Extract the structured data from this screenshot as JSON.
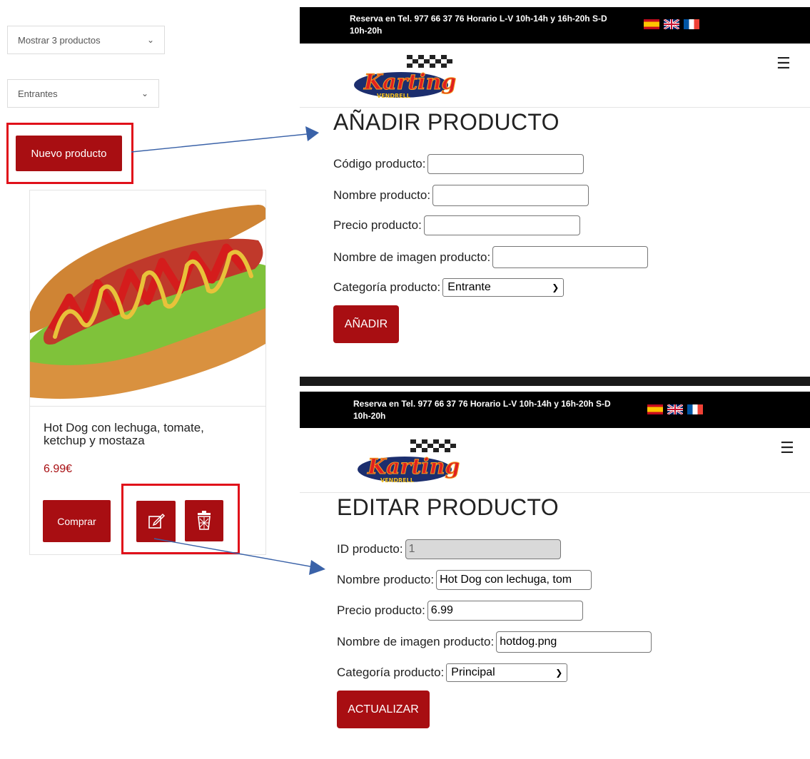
{
  "left": {
    "show_select": "Mostrar 3 productos",
    "category_select": "Entrantes",
    "new_product_button": "Nuevo producto",
    "product": {
      "name": "Hot Dog con lechuga, tomate, ketchup y mostaza",
      "price": "6.99€",
      "buy_button": "Comprar"
    }
  },
  "topbar": {
    "text_line1": "Reserva en Tel. 977 66 37 76 Horario L-V 10h-14h y 16h-20h S-D",
    "text_line2": "10h-20h"
  },
  "logo": {
    "text": "Karting",
    "subtext": "VENDRELL"
  },
  "add_form": {
    "title": "AÑADIR PRODUCTO",
    "code_label": "Código producto:",
    "name_label": "Nombre producto:",
    "price_label": "Precio producto:",
    "image_label": "Nombre de imagen producto:",
    "category_label": "Categoría producto:",
    "category_value": "Entrante",
    "submit": "AÑADIR"
  },
  "edit_form": {
    "title": "EDITAR PRODUCTO",
    "id_label": "ID producto:",
    "id_value": "1",
    "name_label": "Nombre producto:",
    "name_value": "Hot Dog con lechuga, tom",
    "price_label": "Precio producto:",
    "price_value": "6.99",
    "image_label": "Nombre de imagen producto:",
    "image_value": "hotdog.png",
    "category_label": "Categoría producto:",
    "category_value": "Principal",
    "submit": "ACTUALIZAR"
  },
  "colors": {
    "accent": "#a80e12",
    "highlight": "#e0101a",
    "arrow": "#3a62a8"
  }
}
